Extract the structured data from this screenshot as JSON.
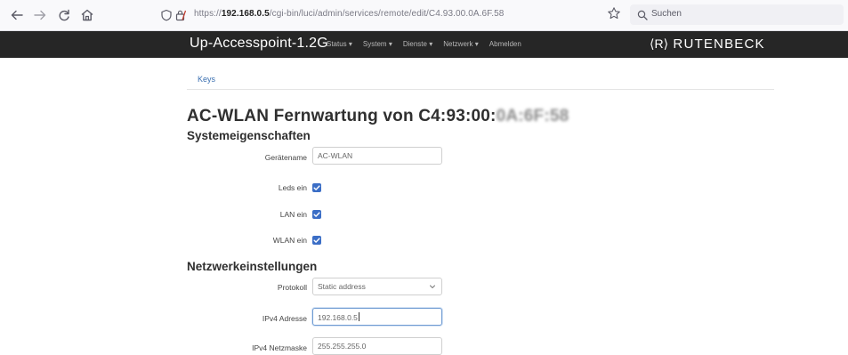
{
  "browser": {
    "url_prefix": "https://",
    "url_host": "192.168.0.5",
    "url_path": "/cgi-bin/luci/admin/services/remote/edit/C4.93.00.0A.6F.58",
    "search_placeholder": "Suchen",
    "icons": [
      "back-arrow-icon",
      "forward-arrow-icon",
      "reload-icon",
      "home-icon",
      "shield-icon",
      "lock-icon",
      "star-icon",
      "search-icon"
    ]
  },
  "header": {
    "brand": "Up-Accesspoint-1.2G",
    "menu": [
      "Status ▾",
      "System ▾",
      "Dienste ▾",
      "Netzwerk ▾",
      "Abmelden"
    ],
    "logo_mark": "⟨R⟩",
    "logo_text": "RUTENBECK"
  },
  "tabs": {
    "keys": "Keys"
  },
  "title": {
    "prefix": "AC-WLAN Fernwartung von C4:93:00:",
    "obscured": "0A:6F:58"
  },
  "system": {
    "heading": "Systemeigenschaften",
    "device_name_label": "Gerätename",
    "device_name_value": "AC-WLAN",
    "leds_label": "Leds ein",
    "leds_checked": true,
    "lan_label": "LAN ein",
    "lan_checked": true,
    "wlan_label": "WLAN ein",
    "wlan_checked": true
  },
  "network": {
    "heading": "Netzwerkeinstellungen",
    "protocol_label": "Protokoll",
    "protocol_value": "Static address",
    "ipv4_label": "IPv4 Adresse",
    "ipv4_value": "192.168.0.5",
    "netmask_label": "IPv4 Netzmaske",
    "netmask_value": "255.255.255.0"
  },
  "colors": {
    "header_bg": "#262626",
    "checkbox": "#3b6ec6",
    "link": "#3a6fb0",
    "focus_border": "#6f9bd2"
  }
}
